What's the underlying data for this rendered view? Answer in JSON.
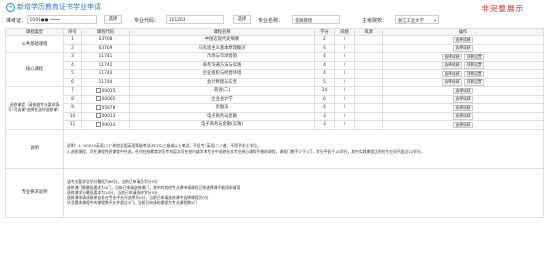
{
  "header": {
    "title": "新增学历教育证书学业申请",
    "status": "非完整展示"
  },
  "form": {
    "ticket_label": "准考证：",
    "ticket_value": "0101●●",
    "select_btn_1": "选择",
    "major_code_label": "专业代码：",
    "major_code_value": "101203",
    "select_btn_2": "选择",
    "major_name_label": "专业名称：",
    "major_name_value": "金融管理",
    "school_label": "主考院校：",
    "school_value": "浙江工业大学"
  },
  "table": {
    "columns": [
      "课程类型",
      "序号",
      "课程代码",
      "课程名称",
      "学分",
      "成绩",
      "来源",
      "操作"
    ],
    "rows": [
      {
        "group": "公共基础课程",
        "num": "1",
        "code": "03708",
        "name": "中国近现代史纲要",
        "credit": "2",
        "score": "/",
        "src": "",
        "ops": [
          "选择成绩"
        ]
      },
      {
        "group": "",
        "num": "2",
        "code": "03709",
        "name": "马克思主义基本原理概论",
        "credit": "4",
        "score": "/",
        "src": "",
        "ops": [
          "选择成绩"
        ]
      },
      {
        "group": "核心课程",
        "num": "3",
        "code": "11741",
        "name": "市场与市场营销",
        "credit": "4",
        "score": "/",
        "src": "",
        "ops": [
          "选择成绩",
          "顶替设置"
        ]
      },
      {
        "group": "",
        "num": "4",
        "code": "11742",
        "name": "商务沟通方法与实践",
        "credit": "4",
        "score": "/",
        "src": "",
        "ops": [
          "选择成绩",
          "顶替设置"
        ]
      },
      {
        "group": "",
        "num": "5",
        "code": "11743",
        "name": "企业组织与经营环境",
        "credit": "4",
        "score": "/",
        "src": "",
        "ops": [
          "选择成绩",
          "顶替设置"
        ]
      },
      {
        "group": "",
        "num": "6",
        "code": "11744",
        "name": "会计原理与实务",
        "credit": "5",
        "score": "/",
        "src": "",
        "ops": [
          "选择成绩",
          "顶替设置"
        ]
      },
      {
        "group": "选修课程（请依据专业要求填写\"可选课\"选择任选的选修课）",
        "num": "7",
        "code": "00015",
        "name": "英语(二)",
        "credit": "14",
        "score": "/",
        "src": "",
        "ops": [
          "选择成绩"
        ]
      },
      {
        "group": "",
        "num": "8",
        "code": "00065",
        "name": "企业会计学",
        "credit": "6",
        "score": "/",
        "src": "",
        "ops": [
          "选择成绩"
        ]
      },
      {
        "group": "",
        "num": "9",
        "code": "05678",
        "name": "金融法",
        "credit": "4",
        "score": "/",
        "src": "",
        "ops": [
          "选择成绩"
        ]
      },
      {
        "group": "",
        "num": "10",
        "code": "00013",
        "name": "电子商务与金融",
        "credit": "3",
        "score": "/",
        "src": "",
        "ops": [
          "选择成绩"
        ]
      },
      {
        "group": "",
        "num": "11",
        "code": "00014",
        "name": "电子商务与金融(实践)",
        "credit": "3",
        "score": "/",
        "src": "",
        "ops": [
          "选择成绩"
        ]
      }
    ],
    "explain_label": "说明",
    "explain_lines": [
      "说明：1.“00015英语(二)”参加全国英语等级考试(PETS)三级或以上笔试，不设专“英语(二)”者，不得予学士学位。",
      "2.选修课程，可在课程性质课程中任选，任何在校教育学历专科层次可在校内或学术专业中选修在本专业核心课程不能的课程，课程门数不少于1门，学分不低于14学分，其中实践课程比例在专业须不超过12学分。"
    ],
    "req_label": "专业要求说明",
    "req_lines": [
      "该专业要求总学分最低为66分，当前已申请总学分0分",
      "选修课门数最低要求为1门，当前已申请选修课门，其中的其他专业课申请课程已按选择课不能再申请用",
      "选修课学分最低要求为14分，当前已申请选修学分0分",
      "选修课申请成绩来自非在专业中允许选择为0分，当前已申请选修课中选择课程为0分",
      "毕业要求课程中的课程数不允许超过3门，当前已申请的课程为专业课程数0门"
    ]
  }
}
